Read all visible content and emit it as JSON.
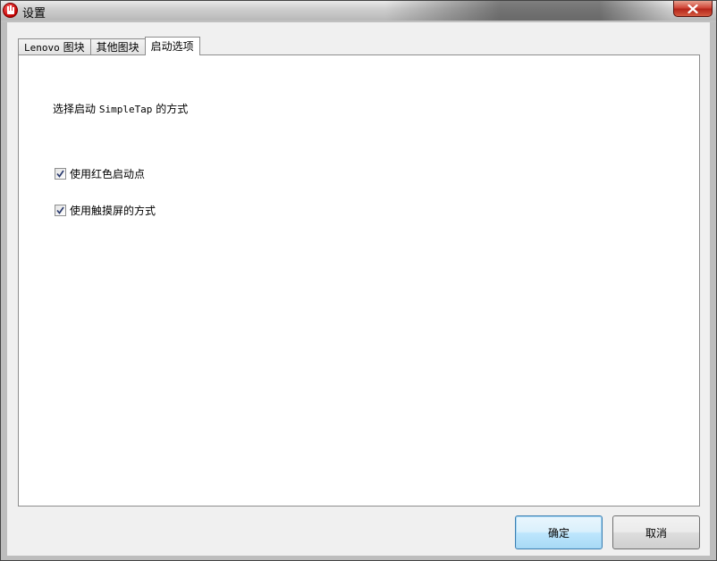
{
  "window": {
    "title": "设置",
    "close_label": "×"
  },
  "tabs": [
    {
      "label_prefix": "Lenovo",
      "label_suffix": " 图块",
      "active": false
    },
    {
      "label": "其他图块",
      "active": false
    },
    {
      "label": "启动选项",
      "active": true
    }
  ],
  "startup": {
    "prompt_prefix": "选择启动 ",
    "prompt_app": "SimpleTap",
    "prompt_suffix": " 的方式",
    "options": [
      {
        "label": "使用红色启动点",
        "checked": true
      },
      {
        "label": "使用触摸屏的方式",
        "checked": true
      }
    ]
  },
  "buttons": {
    "ok_label": "确定",
    "cancel_label": "取消"
  },
  "colors": {
    "close_red": "#c8372a",
    "default_button_blue": "#3c7fb1"
  }
}
